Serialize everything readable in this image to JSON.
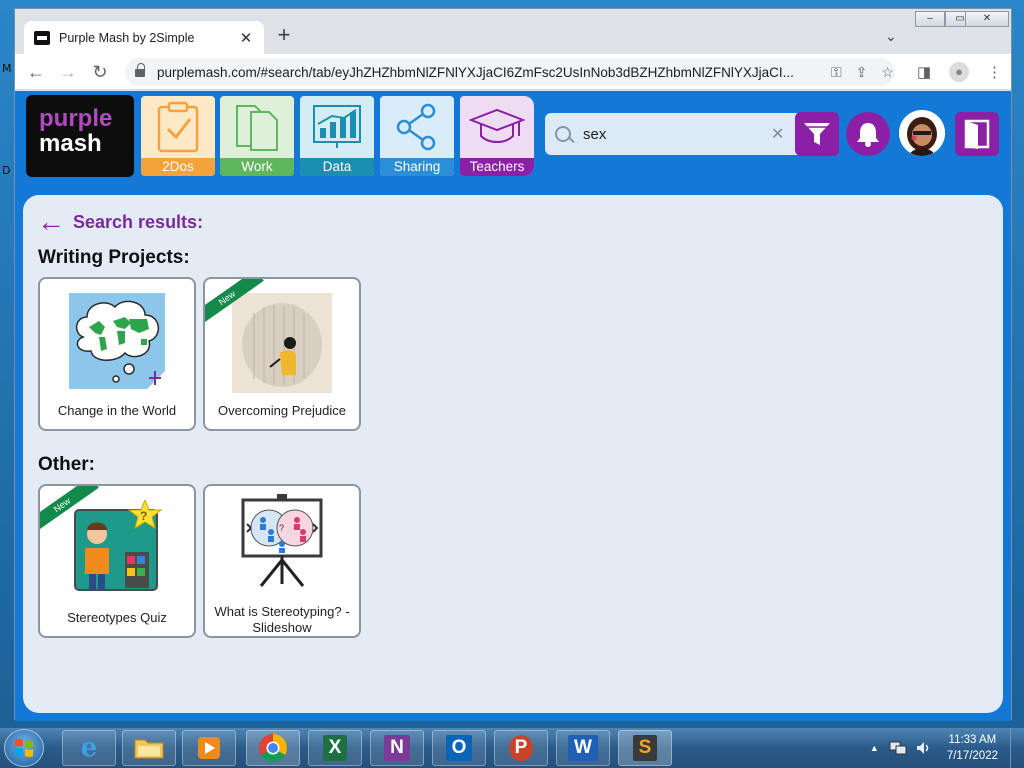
{
  "desktop": {
    "edge_letters": [
      "M",
      "D"
    ]
  },
  "browser": {
    "tab_title": "Purple Mash by 2Simple",
    "tab_close": "✕",
    "new_tab": "+",
    "tab_search": "⌄",
    "win_min": "–",
    "win_max": "▭",
    "win_close": "✕",
    "back": "←",
    "forward": "→",
    "reload": "↻",
    "url": "purplemash.com/#search/tab/eyJhZHZhbmNlZFNlYXJjaCI6ZmFsc2UsInNob3dBZHZhbmNlZFNlYXJjaCI...",
    "key": "⚿",
    "share": "⇪",
    "star": "☆",
    "sidepanel": "◨",
    "profile": "●",
    "menu": "⋮"
  },
  "app": {
    "logo": {
      "line1": "purple",
      "line2": "mash"
    },
    "nav": [
      {
        "label": "2Dos",
        "color": "#f5a23a",
        "bg": "#fde9c6",
        "icon": "clipboard-check-icon"
      },
      {
        "label": "Work",
        "color": "#5fb65f",
        "bg": "#dff0d8",
        "icon": "documents-icon"
      },
      {
        "label": "Data",
        "color": "#1a8fb0",
        "bg": "#d4ecf4",
        "icon": "data-board-icon"
      },
      {
        "label": "Sharing",
        "color": "#2b8ed6",
        "bg": "#d9ecfa",
        "icon": "share-icon"
      },
      {
        "label": "Teachers",
        "color": "#8b1fa6",
        "bg": "#eedcf3",
        "icon": "graduation-cap-icon"
      }
    ],
    "search": {
      "value": "sex",
      "clear": "✕"
    },
    "accent": "#8b1fa6"
  },
  "results": {
    "back_label": "Search results:",
    "sections": [
      {
        "title": "Writing Projects:",
        "items": [
          {
            "caption": "Change in the World",
            "new": false
          },
          {
            "caption": "Overcoming Prejudice",
            "new": true
          }
        ]
      },
      {
        "title": "Other:",
        "items": [
          {
            "caption": "Stereotypes Quiz",
            "new": true
          },
          {
            "caption": "What is Stereotyping? - Slideshow",
            "new": false
          }
        ]
      }
    ],
    "new_badge": "New"
  },
  "taskbar": {
    "apps": [
      "ie",
      "explorer",
      "media",
      "chrome",
      "excel",
      "onenote",
      "outlook",
      "powerpoint",
      "word",
      "sublime"
    ],
    "excel_glyph": "X",
    "onenote_glyph": "N",
    "outlook_glyph": "O",
    "ppt_glyph": "P",
    "word_glyph": "W",
    "ie_glyph": "e",
    "sublime_glyph": "S",
    "time": "11:33 AM",
    "date": "7/17/2022"
  }
}
